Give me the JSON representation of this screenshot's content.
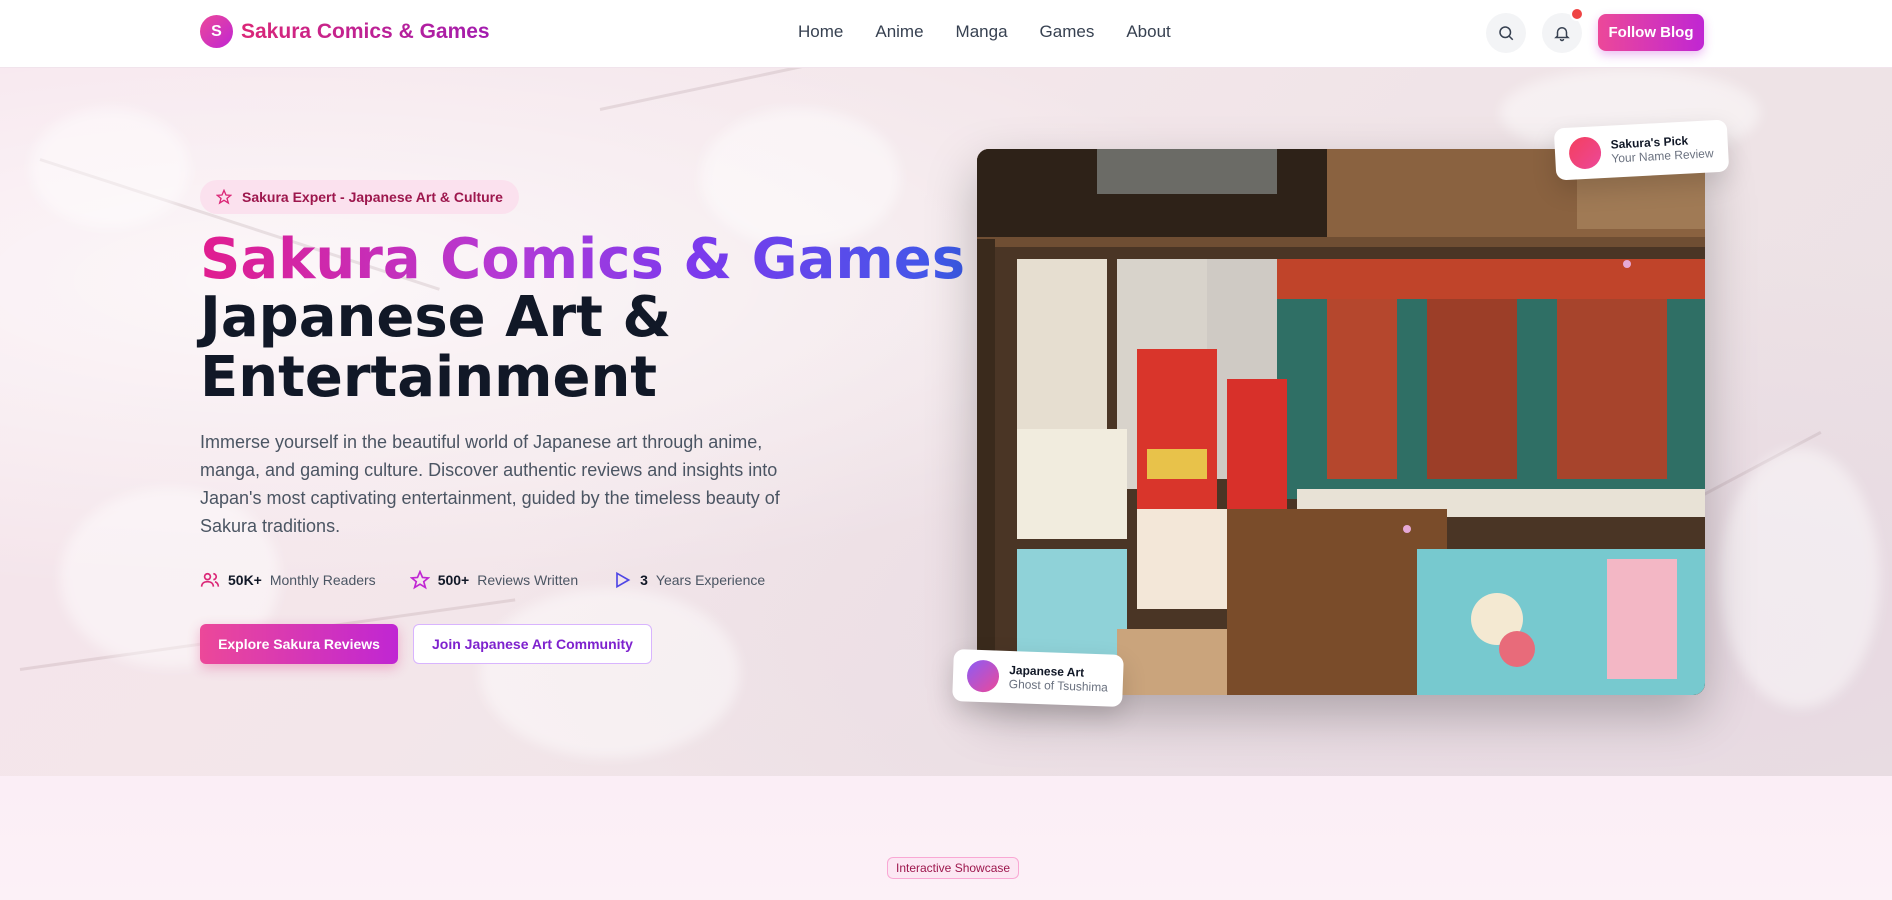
{
  "brand": {
    "initial": "S",
    "name": "Sakura Comics & Games"
  },
  "nav": {
    "links": [
      "Home",
      "Anime",
      "Manga",
      "Games",
      "About"
    ],
    "follow_label": "Follow Blog"
  },
  "hero": {
    "badge": "Sakura Expert - Japanese Art & Culture",
    "title_gradient": "Sakura Comics & Games",
    "title_line2": "Japanese Art &",
    "title_line3": "Entertainment",
    "description": "Immerse yourself in the beautiful world of Japanese art through anime, manga, and gaming culture. Discover authentic reviews and insights into Japan's most captivating entertainment, guided by the timeless beauty of Sakura traditions.",
    "stats": [
      {
        "icon": "users-icon",
        "value": "50K+",
        "label": "Monthly Readers"
      },
      {
        "icon": "star-icon",
        "value": "500+",
        "label": "Reviews Written"
      },
      {
        "icon": "play-icon",
        "value": "3",
        "label": "Years Experience"
      }
    ],
    "primary_cta": "Explore Sakura Reviews",
    "secondary_cta": "Join Japanese Art Community"
  },
  "cards": {
    "pick": {
      "title": "Sakura's Pick",
      "subtitle": "Your Name Review"
    },
    "art": {
      "title": "Japanese Art",
      "subtitle": "Ghost of Tsushima"
    }
  },
  "showcase": {
    "tag": "Interactive Showcase"
  },
  "colors": {
    "accent": "#ec4899",
    "accent2": "#c026d3",
    "dark": "#111827"
  }
}
